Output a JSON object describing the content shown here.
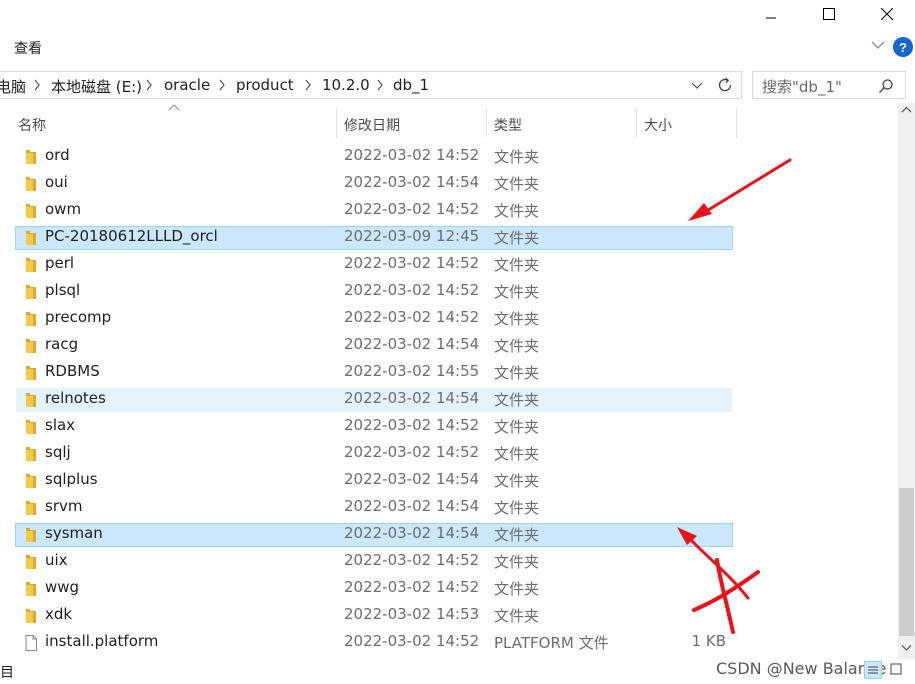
{
  "ribbon": {
    "tab": "查看"
  },
  "address": {
    "crumbs": [
      "电脑",
      "本地磁盘 (E:)",
      "oracle",
      "product",
      "10.2.0",
      "db_1"
    ]
  },
  "search": {
    "placeholder": "搜索\"db_1\""
  },
  "columns": {
    "name": "名称",
    "date": "修改日期",
    "type": "类型",
    "size": "大小"
  },
  "files": [
    {
      "name": "ord",
      "date": "2022-03-02 14:52",
      "type": "文件夹",
      "size": "",
      "kind": "folder"
    },
    {
      "name": "oui",
      "date": "2022-03-02 14:54",
      "type": "文件夹",
      "size": "",
      "kind": "folder"
    },
    {
      "name": "owm",
      "date": "2022-03-02 14:52",
      "type": "文件夹",
      "size": "",
      "kind": "folder"
    },
    {
      "name": "PC-20180612LLLD_orcl",
      "date": "2022-03-09 12:45",
      "type": "文件夹",
      "size": "",
      "kind": "folder",
      "state": "selected"
    },
    {
      "name": "perl",
      "date": "2022-03-02 14:52",
      "type": "文件夹",
      "size": "",
      "kind": "folder"
    },
    {
      "name": "plsql",
      "date": "2022-03-02 14:52",
      "type": "文件夹",
      "size": "",
      "kind": "folder"
    },
    {
      "name": "precomp",
      "date": "2022-03-02 14:52",
      "type": "文件夹",
      "size": "",
      "kind": "folder"
    },
    {
      "name": "racg",
      "date": "2022-03-02 14:54",
      "type": "文件夹",
      "size": "",
      "kind": "folder"
    },
    {
      "name": "RDBMS",
      "date": "2022-03-02 14:55",
      "type": "文件夹",
      "size": "",
      "kind": "folder"
    },
    {
      "name": "relnotes",
      "date": "2022-03-02 14:54",
      "type": "文件夹",
      "size": "",
      "kind": "folder",
      "state": "hover"
    },
    {
      "name": "slax",
      "date": "2022-03-02 14:52",
      "type": "文件夹",
      "size": "",
      "kind": "folder"
    },
    {
      "name": "sqlj",
      "date": "2022-03-02 14:52",
      "type": "文件夹",
      "size": "",
      "kind": "folder"
    },
    {
      "name": "sqlplus",
      "date": "2022-03-02 14:54",
      "type": "文件夹",
      "size": "",
      "kind": "folder"
    },
    {
      "name": "srvm",
      "date": "2022-03-02 14:54",
      "type": "文件夹",
      "size": "",
      "kind": "folder"
    },
    {
      "name": "sysman",
      "date": "2022-03-02 14:54",
      "type": "文件夹",
      "size": "",
      "kind": "folder",
      "state": "selected"
    },
    {
      "name": "uix",
      "date": "2022-03-02 14:52",
      "type": "文件夹",
      "size": "",
      "kind": "folder"
    },
    {
      "name": "wwg",
      "date": "2022-03-02 14:52",
      "type": "文件夹",
      "size": "",
      "kind": "folder"
    },
    {
      "name": "xdk",
      "date": "2022-03-02 14:53",
      "type": "文件夹",
      "size": "",
      "kind": "folder"
    },
    {
      "name": "install.platform",
      "date": "2022-03-02 14:52",
      "type": "PLATFORM 文件",
      "size": "1 KB",
      "kind": "file"
    }
  ],
  "status": {
    "left": "目"
  },
  "watermark": "CSDN @New Balance",
  "colors": {
    "selected_bg": "#cce8ff",
    "selected_border": "#99d1ff",
    "hover_bg": "#e5f3ff",
    "folder": "#f7c948",
    "annotation_red": "#e8141a"
  }
}
